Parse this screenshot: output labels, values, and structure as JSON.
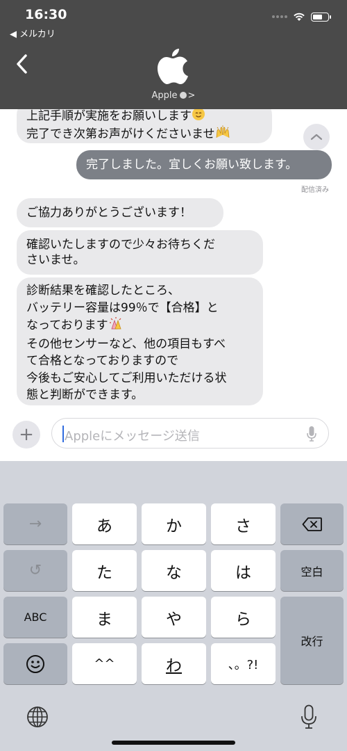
{
  "status_bar": {
    "time": "16:30",
    "back_app": "◀ メルカリ",
    "battery_level": 0.7
  },
  "header": {
    "back_icon": "chevron-left-icon",
    "logo_icon": "apple-logo-icon",
    "contact_name": "Apple",
    "contact_chevron": ">"
  },
  "messages": [
    {
      "direction": "in",
      "text_line1": "上記手順が実施をお願いします",
      "text_line2": "完了でき次第お声がけくださいませ"
    },
    {
      "direction": "out",
      "text": "完了しました。宜しくお願い致します。",
      "status": "配信済み"
    },
    {
      "direction": "in",
      "text": "ご協力ありがとうございます！"
    },
    {
      "direction": "in",
      "text_line1": "確認いたしますので少々お待ちくだ",
      "text_line2": "さいませ。"
    },
    {
      "direction": "in",
      "text_line1": "診断結果を確認したところ、",
      "text_line2": "バッテリー容量は99％で【合格】と",
      "text_line3": "なっております",
      "text_line4": "その他センサーなど、他の項目もすべ",
      "text_line5": "て合格となっておりますので",
      "text_line6": "今後もご安心してご利用いただける状",
      "text_line7": "態と判断ができます。"
    }
  ],
  "input": {
    "placeholder": "Appleにメッセージ送信",
    "plus_label": "+",
    "mic_icon": "microphone-icon"
  },
  "keyboard": {
    "left_col": [
      "→",
      "↺",
      "ABC",
      "☺"
    ],
    "rows": [
      [
        "あ",
        "か",
        "さ"
      ],
      [
        "た",
        "な",
        "は"
      ],
      [
        "ま",
        "や",
        "ら"
      ],
      [
        "^^",
        "わ",
        "、。?!"
      ]
    ],
    "delete_icon": "backspace-icon",
    "space_label": "空白",
    "return_label": "改行",
    "globe_icon": "globe-icon",
    "dictation_icon": "microphone-icon"
  },
  "colors": {
    "header_bg": "#4a4a4a",
    "incoming_bubble": "#e9e9eb",
    "outgoing_bubble": "#7c8087",
    "keyboard_bg": "#d1d4db",
    "caret": "#2f6bdf"
  }
}
